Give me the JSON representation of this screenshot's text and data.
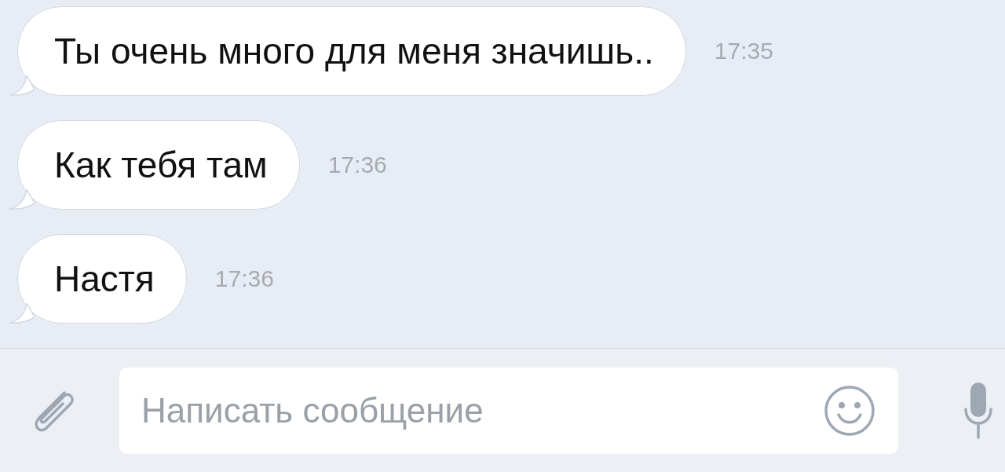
{
  "messages": [
    {
      "text": "Ты очень много для меня значишь..",
      "time": "17:35"
    },
    {
      "text": "Как тебя там",
      "time": "17:36"
    },
    {
      "text": "Настя",
      "time": "17:36"
    }
  ],
  "composer": {
    "placeholder": "Написать сообщение"
  }
}
